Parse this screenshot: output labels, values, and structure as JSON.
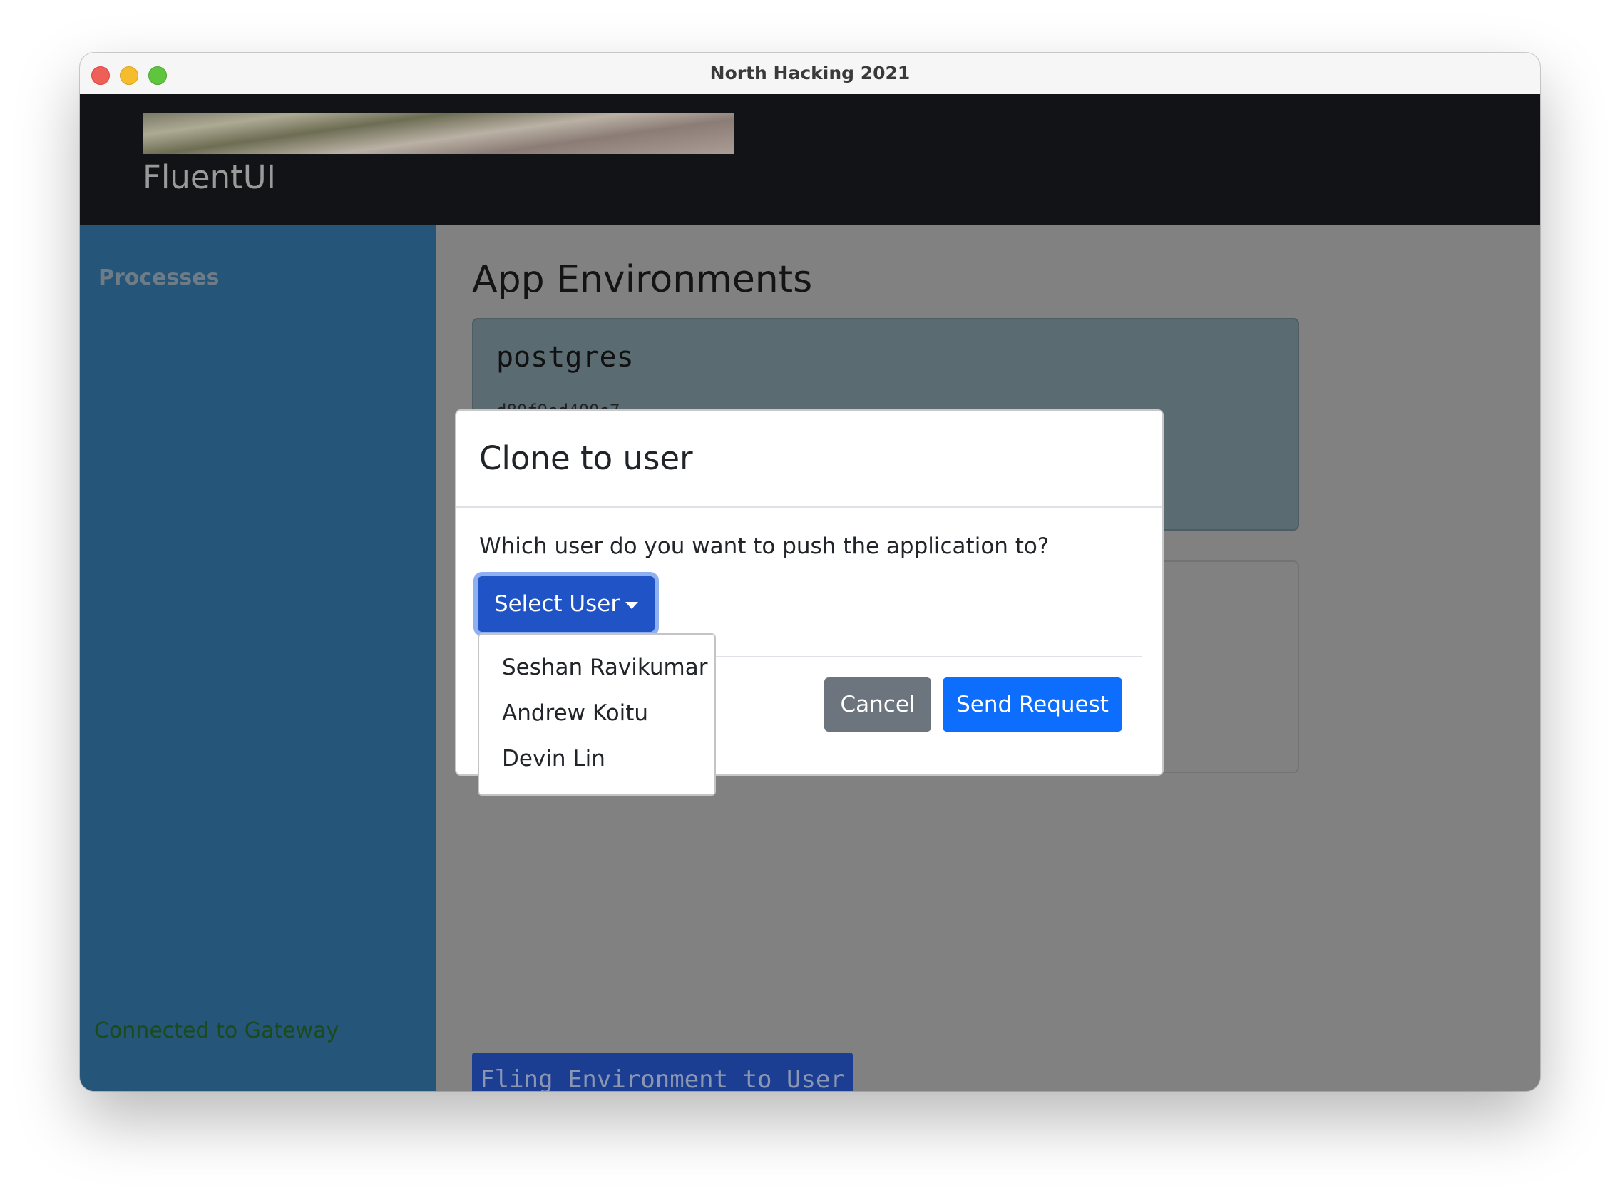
{
  "window": {
    "title": "North Hacking 2021"
  },
  "header": {
    "brand": "FluentUI",
    "banner_icon": "banner-image"
  },
  "sidebar": {
    "items": [
      {
        "label": "Processes"
      }
    ],
    "status": "Connected to Gateway",
    "status_color": "#1b4a1b"
  },
  "main": {
    "title": "App Environments",
    "environments": [
      {
        "name": "postgres",
        "id": "d80f9ed400e7"
      }
    ],
    "fling_button": "Fling Environment to User"
  },
  "modal": {
    "title": "Clone to user",
    "question": "Which user do you want to push the application to?",
    "select_label": "Select User",
    "users": [
      "Seshan Ravikumar",
      "Andrew Koitu",
      "Devin Lin"
    ],
    "cancel_label": "Cancel",
    "send_label": "Send Request"
  },
  "colors": {
    "sidebar": "#255578",
    "primary": "#0d6efd",
    "secondary": "#6c757d",
    "select_button": "#2053c5",
    "header": "#121316"
  }
}
